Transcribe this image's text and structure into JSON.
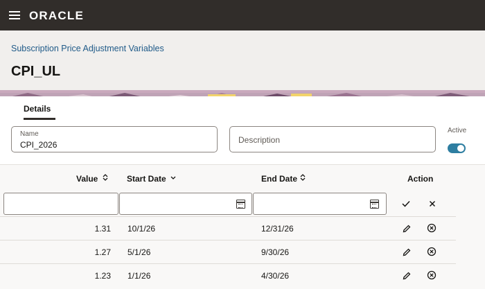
{
  "app": {
    "brand": "ORACLE",
    "menu_icon": "hamburger-menu-icon"
  },
  "header": {
    "breadcrumb": "Subscription Price Adjustment Variables",
    "title": "CPI_UL"
  },
  "tabs": [
    {
      "label": "Details",
      "selected": true
    }
  ],
  "form": {
    "name_label": "Name",
    "name_value": "CPI_2026",
    "description_placeholder": "Description",
    "active_label": "Active",
    "active": true
  },
  "table": {
    "columns": {
      "value": "Value",
      "start_date": "Start Date",
      "end_date": "End Date",
      "action": "Action"
    },
    "filter_icons": {
      "calendar": "calendar-icon",
      "apply": "checkmark-icon",
      "clear": "close-icon"
    },
    "rows": [
      {
        "value": "1.31",
        "start_date": "10/1/26",
        "end_date": "12/31/26"
      },
      {
        "value": "1.27",
        "start_date": "5/1/26",
        "end_date": "9/30/26"
      },
      {
        "value": "1.23",
        "start_date": "1/1/26",
        "end_date": "4/30/26"
      }
    ]
  },
  "colors": {
    "topbar": "#312d2a",
    "accent": "#2e7ea1",
    "link": "#1f5a88",
    "header_bg": "#f1efed"
  }
}
